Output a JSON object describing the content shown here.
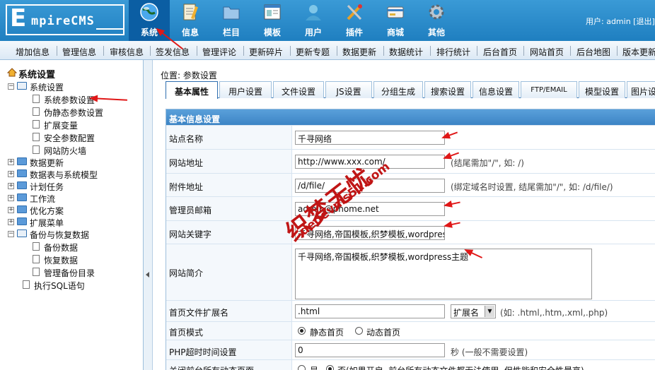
{
  "logo": {
    "initial": "E",
    "text": "mpireCMS"
  },
  "top_nav": [
    {
      "label": "系统",
      "icon": "globe-icon",
      "active": true
    },
    {
      "label": "信息",
      "icon": "notepad-icon"
    },
    {
      "label": "栏目",
      "icon": "folder-icon"
    },
    {
      "label": "模板",
      "icon": "template-window-icon"
    },
    {
      "label": "用户",
      "icon": "user-icon"
    },
    {
      "label": "插件",
      "icon": "tools-icon"
    },
    {
      "label": "商城",
      "icon": "shop-card-icon"
    },
    {
      "label": "其他",
      "icon": "gear-icon"
    }
  ],
  "user_bar": {
    "text": "用户: admin [退出]"
  },
  "sub_nav": [
    "增加信息",
    "管理信息",
    "审核信息",
    "签发信息",
    "管理评论",
    "更新碎片",
    "更新专题",
    "数据更新",
    "数据统计",
    "排行统计",
    "后台首页",
    "网站首页",
    "后台地图",
    "版本更新"
  ],
  "sidebar": {
    "title": "系统设置",
    "groups": [
      {
        "label": "系统设置",
        "expanded": true,
        "children": [
          "系统参数设置",
          "伪静态参数设置",
          "扩展变量",
          "安全参数配置",
          "网站防火墙"
        ]
      },
      {
        "label": "数据更新"
      },
      {
        "label": "数据表与系统模型"
      },
      {
        "label": "计划任务"
      },
      {
        "label": "工作流"
      },
      {
        "label": "优化方案"
      },
      {
        "label": "扩展菜单"
      },
      {
        "label": "备份与恢复数据",
        "expanded": true,
        "children": [
          "备份数据",
          "恢复数据",
          "管理备份目录",
          "执行SQL语句"
        ]
      }
    ]
  },
  "breadcrumb": "位置: 参数设置",
  "tabs": [
    "基本属性",
    "用户设置",
    "文件设置",
    "JS设置",
    "分组生成",
    "搜索设置",
    "信息设置",
    "FTP/EMAIL",
    "模型设置",
    "图片设置"
  ],
  "form": {
    "section_title": "基本信息设置",
    "site_name": {
      "label": "站点名称",
      "value": "千寻网络"
    },
    "site_url": {
      "label": "网站地址",
      "value": "http://www.xxx.com/",
      "hint": "(结尾需加\"/\", 如: /)"
    },
    "attach_url": {
      "label": "附件地址",
      "value": "/d/file/",
      "hint": "(绑定域名时设置, 结尾需加\"/\", 如: /d/file/)"
    },
    "admin_email": {
      "label": "管理员邮箱",
      "value": "admin@phome.net"
    },
    "keywords": {
      "label": "网站关键字",
      "value": "千寻网络,帝国模板,织梦模板,wordpress主题"
    },
    "intro": {
      "label": "网站简介",
      "value": "千寻网络,帝国模板,织梦模板,wordpress主题"
    },
    "index_ext": {
      "label": "首页文件扩展名",
      "value": ".html",
      "select": "扩展名",
      "hint": "(如: .html,.htm,.xml,.php)"
    },
    "index_mode": {
      "label": "首页模式",
      "options": [
        "静态首页",
        "动态首页"
      ],
      "selected": 0
    },
    "php_timeout": {
      "label": "PHP超时时间设置",
      "value": "0",
      "hint": "秒 (一般不需要设置)"
    },
    "close_dynamic": {
      "label": "关闭前台所有动态页面",
      "options": [
        "是",
        "否(如果开启, 前台所有动态文件都无法使用, 但性能和安全性最高)"
      ],
      "selected": 1
    }
  },
  "watermark": {
    "line1": "织梦无忧",
    "line2": "dedevms51.com"
  },
  "colors": {
    "header_blue": "#2b8ccc",
    "active_nav": "#0b5ea3",
    "annotation_red": "#e01818"
  }
}
